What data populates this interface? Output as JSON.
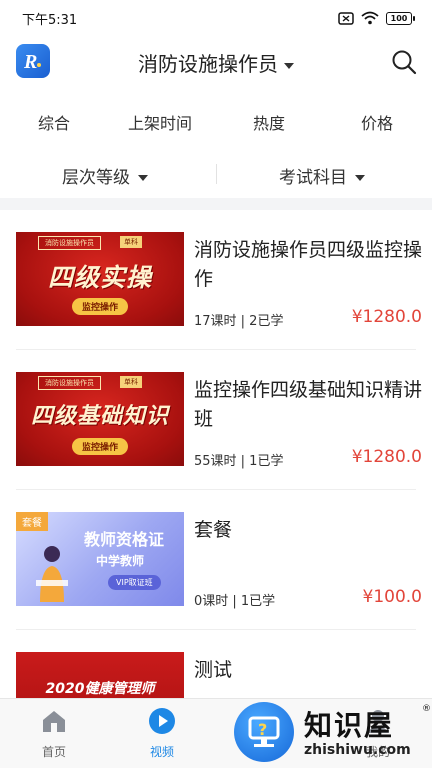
{
  "status_bar": {
    "time": "下午5:31",
    "battery": "100"
  },
  "header": {
    "title": "消防设施操作员",
    "icons": {
      "logo": "app-logo",
      "search": "search-icon"
    }
  },
  "sort_tabs": [
    {
      "label": "综合"
    },
    {
      "label": "上架时间"
    },
    {
      "label": "热度"
    },
    {
      "label": "价格"
    }
  ],
  "filters": [
    {
      "label": "层次等级"
    },
    {
      "label": "考试科目"
    }
  ],
  "courses": [
    {
      "title": "消防设施操作员四级监控操作",
      "meta": "17课时 | 2已学",
      "price": "¥1280.0",
      "thumb": {
        "tag": "消防设施操作员",
        "tag2": "单科",
        "headline": "四级实操",
        "pill": "监控操作"
      }
    },
    {
      "title": "监控操作四级基础知识精讲班",
      "meta": "55课时 | 1已学",
      "price": "¥1280.0",
      "thumb": {
        "tag": "消防设施操作员",
        "tag2": "单科",
        "headline": "四级基础知识",
        "pill": "监控操作"
      }
    },
    {
      "title": "套餐",
      "meta": "0课时 | 1已学",
      "price": "¥100.0",
      "thumb": {
        "corner": "套餐",
        "line1": "教师资格证",
        "line2": "中学教师",
        "line3": "VIP取证班"
      }
    },
    {
      "title": "测试",
      "meta": "",
      "price": "",
      "thumb": {
        "headline": "2020健康管理师"
      }
    }
  ],
  "bottom_nav": [
    {
      "label": "首页",
      "icon": "home-icon"
    },
    {
      "label": "视频",
      "icon": "play-icon"
    },
    {
      "label": "我的",
      "icon": "profile-icon"
    }
  ],
  "watermark": {
    "name": "知识屋",
    "url": "zhishiwu.com",
    "reg": "®"
  },
  "colors": {
    "accent": "#1e88e5",
    "price": "#e2453a"
  }
}
